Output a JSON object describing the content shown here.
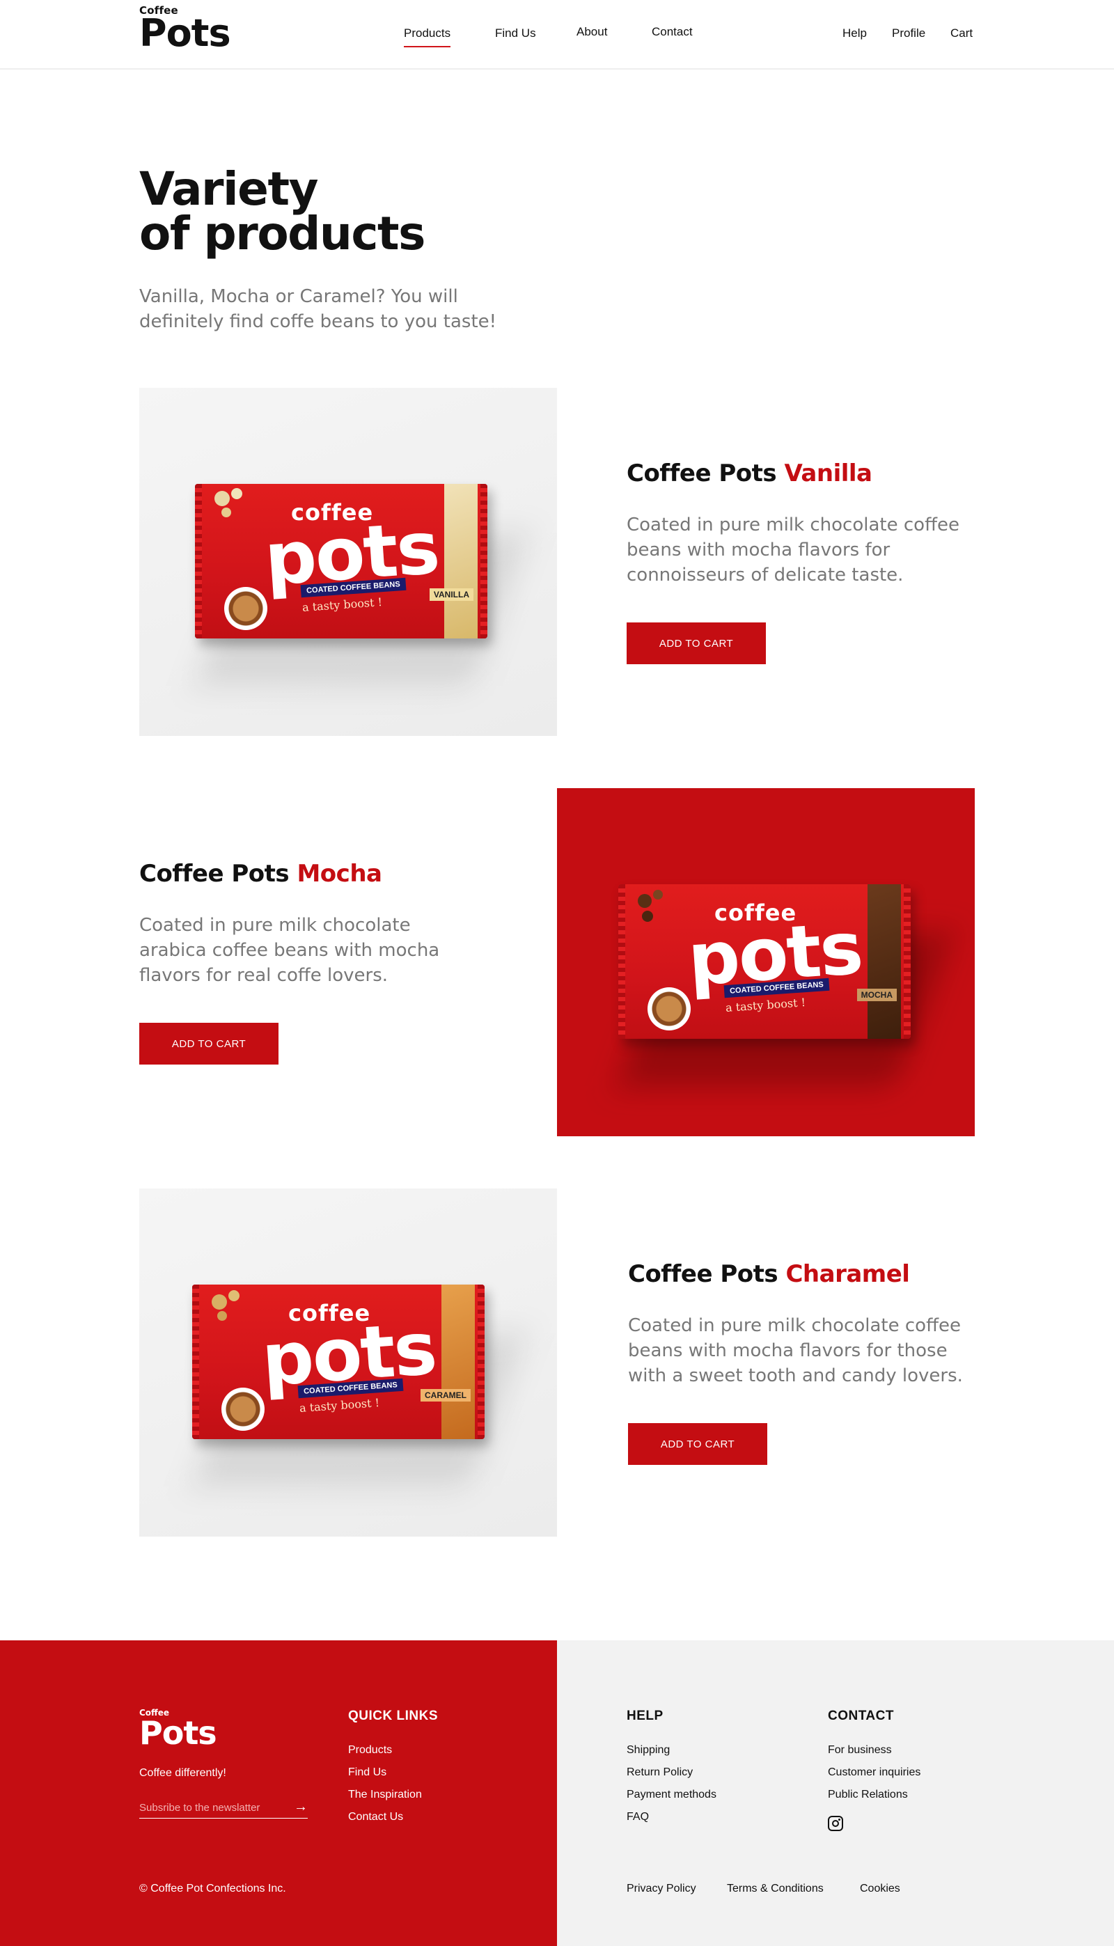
{
  "header": {
    "logo_small": "Coffee",
    "logo_big": "Pots",
    "nav": [
      {
        "label": "Products",
        "active": true
      },
      {
        "label": "Find Us",
        "active": false
      },
      {
        "label": "About",
        "active": false
      },
      {
        "label": "Contact",
        "active": false
      }
    ],
    "right_nav": [
      {
        "label": "Help"
      },
      {
        "label": "Profile"
      },
      {
        "label": "Cart"
      }
    ]
  },
  "hero": {
    "title_line1": "Variety",
    "title_line2": "of products",
    "subtitle": "Vanilla, Mocha or Caramel? You will definitely find coffe beans to you taste!"
  },
  "products": [
    {
      "title_prefix": "Coffee Pots ",
      "title_accent": "Vanilla",
      "description": "Coated in pure milk chocolate coffee beans with mocha flavors for connoisseurs of delicate taste.",
      "button": "ADD TO CART",
      "pack": {
        "word1": "coffee",
        "word2": "pots",
        "tag": "COATED COFFEE BEANS",
        "slogan": "a tasty boost !",
        "flavor": "VANILLA"
      }
    },
    {
      "title_prefix": "Coffee Pots ",
      "title_accent": "Mocha",
      "description": "Coated in pure milk chocolate arabica coffee beans with mocha flavors for real coffe lovers.",
      "button": "ADD TO CART",
      "pack": {
        "word1": "coffee",
        "word2": "pots",
        "tag": "COATED COFFEE BEANS",
        "slogan": "a tasty boost !",
        "flavor": "MOCHA"
      }
    },
    {
      "title_prefix": "Coffee Pots ",
      "title_accent": "Charamel",
      "description": "Coated in pure milk chocolate coffee beans with mocha flavors for those with a sweet tooth and candy lovers.",
      "button": "ADD TO CART",
      "pack": {
        "word1": "coffee",
        "word2": "pots",
        "tag": "COATED COFFEE BEANS",
        "slogan": "a tasty boost !",
        "flavor": "CARAMEL"
      }
    }
  ],
  "footer": {
    "logo_small": "Coffee",
    "logo_big": "Pots",
    "tagline": "Coffee differently!",
    "newsletter_placeholder": "Subsribe to the newslatter",
    "newsletter_arrow": "→",
    "quick_links_title": "QUICK LINKS",
    "quick_links": [
      "Products",
      "Find Us",
      "The Inspiration",
      "Contact Us"
    ],
    "help_title": "HELP",
    "help_links": [
      "Shipping",
      "Return Policy",
      "Payment methods",
      "FAQ"
    ],
    "contact_title": "CONTACT",
    "contact_links": [
      "For business",
      "Customer inquiries",
      "Public Relations"
    ],
    "copyright": "© Coffee Pot Confections Inc.",
    "bottom_links": [
      "Privacy Policy",
      "Terms & Conditions",
      "Cookies"
    ]
  },
  "colors": {
    "brand_red": "#c40d12",
    "text_dark": "#111111",
    "text_grey": "#777777",
    "panel_grey": "#f2f2f2"
  },
  "icons": [
    "instagram-icon",
    "arrow-right-icon"
  ]
}
